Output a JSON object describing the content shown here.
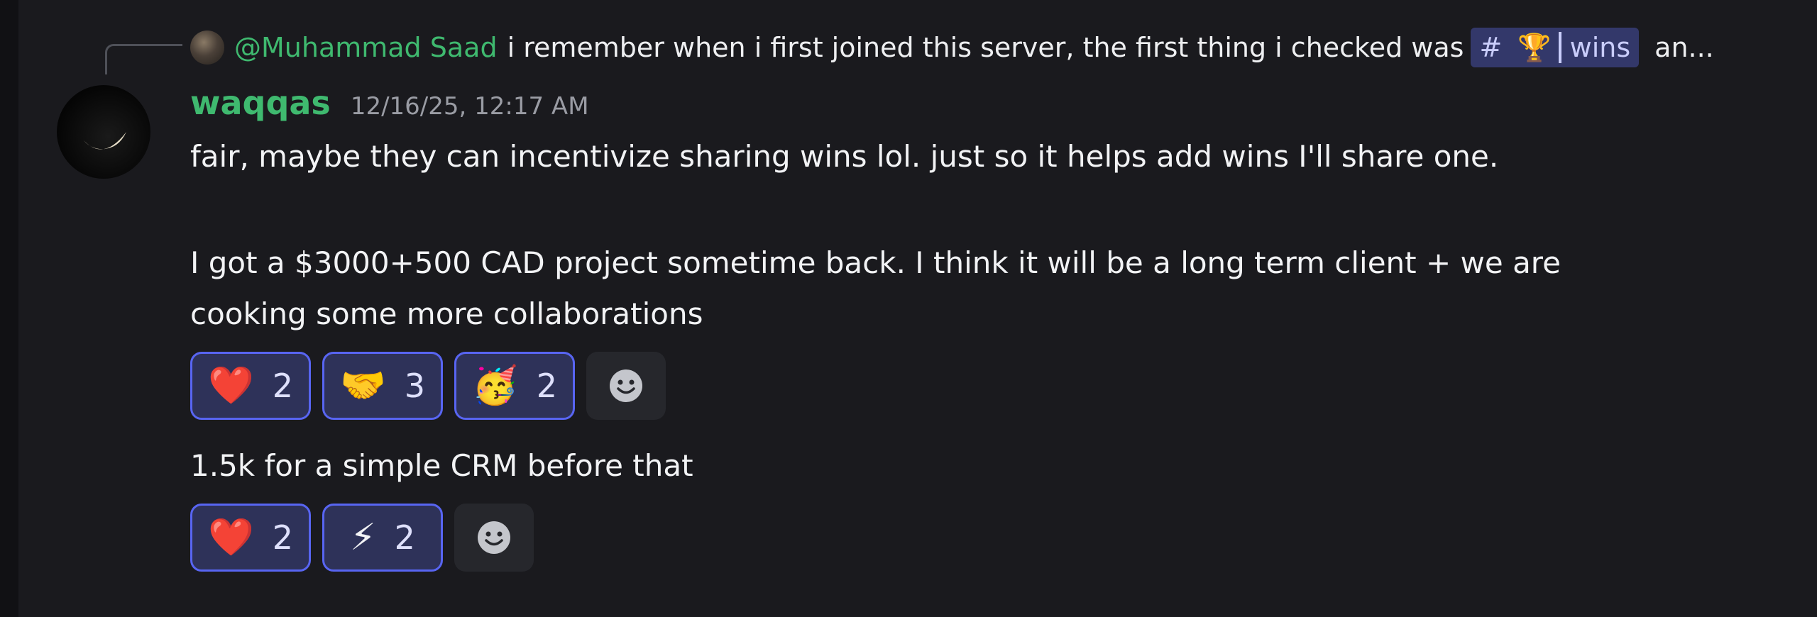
{
  "reply": {
    "author": "@Muhammad Saad",
    "text": "i remember when i first joined this server, the first thing i checked was",
    "channel": {
      "hash": "#",
      "emoji": "🏆",
      "name": "wins"
    },
    "ellipsis": "an..."
  },
  "message": {
    "author": "waqqas",
    "timestamp": "12/16/25, 12:17 AM",
    "line1": "fair, maybe they can incentivize sharing wins lol. just so it helps add wins I'll share one.",
    "line2": "I got a $3000+500 CAD project sometime back. I think it will be a long term client + we are",
    "line3": "cooking some more collaborations"
  },
  "reactions_1": [
    {
      "emoji": "❤️",
      "icon": "heart-icon",
      "count": "2"
    },
    {
      "emoji": "🤝",
      "icon": "handshake-icon",
      "count": "3"
    },
    {
      "emoji": "🥳",
      "icon": "partying-face-icon",
      "count": "2"
    }
  ],
  "followup": {
    "text": "1.5k for a simple CRM before that"
  },
  "reactions_2": [
    {
      "emoji": "❤️",
      "icon": "heart-icon",
      "count": "2"
    },
    {
      "emoji": "⚡",
      "icon": "lightning-icon",
      "count": "2"
    }
  ],
  "colors": {
    "background": "#1a1a1e",
    "username": "#3fb96f",
    "reaction_bg": "#2e3259",
    "reaction_border": "#5865f2",
    "channel_chip_bg": "#33386a"
  }
}
